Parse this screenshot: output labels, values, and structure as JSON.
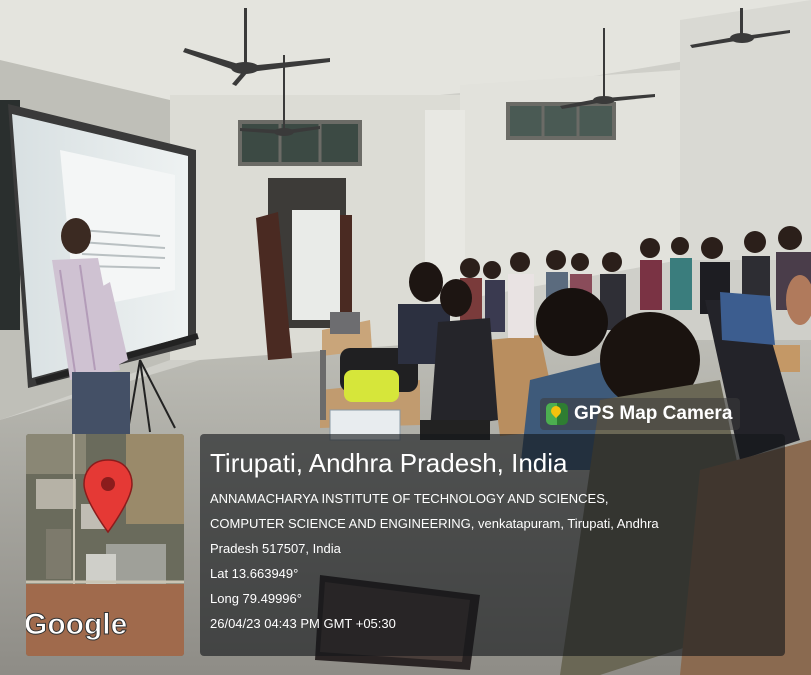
{
  "badge": {
    "label": "GPS Map Camera",
    "icon": "gps-map-camera-icon"
  },
  "map": {
    "attribution": "Google",
    "marker": "map-pin-icon"
  },
  "location": {
    "title": "Tirupati, Andhra Pradesh, India",
    "address_line_1": "ANNAMACHARYA INSTITUTE OF TECHNOLOGY AND SCIENCES,",
    "address_line_2": "COMPUTER SCIENCE AND ENGINEERING, venkatapuram, Tirupati, Andhra",
    "address_line_3": "Pradesh 517507, India",
    "lat": "Lat 13.663949°",
    "long": "Long 79.49996°",
    "timestamp": "26/04/23 04:43 PM GMT +05:30"
  },
  "colors": {
    "pin": "#e53935",
    "overlay": "#14161a",
    "gps_green": "#2e7d32",
    "wall": "#dadad4"
  }
}
